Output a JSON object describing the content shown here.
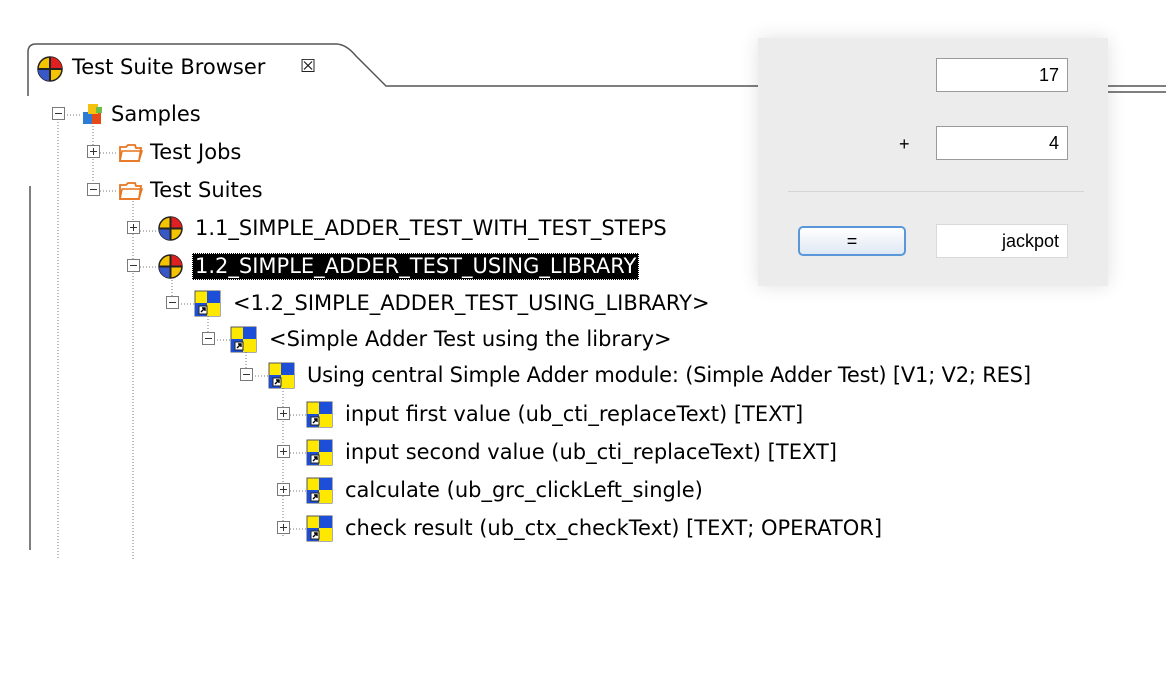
{
  "view": {
    "tab_title": "Test Suite Browser",
    "close_glyph": "☒",
    "tab_icon": "test-suite-icon"
  },
  "tree": {
    "rows": [
      {
        "label": "Samples",
        "icon": "category-icon"
      },
      {
        "label": "Test Jobs",
        "icon": "folder-icon"
      },
      {
        "label": "Test Suites",
        "icon": "folder-icon"
      },
      {
        "label": "1.1_SIMPLE_ADDER_TEST_WITH_TEST_STEPS",
        "icon": "test-suite-icon"
      },
      {
        "label": "1.2_SIMPLE_ADDER_TEST_USING_LIBRARY",
        "icon": "test-suite-icon",
        "selected": true
      },
      {
        "label": "<1.2_SIMPLE_ADDER_TEST_USING_LIBRARY>",
        "icon": "test-case-reference-icon"
      },
      {
        "label": "<Simple Adder Test using the library>",
        "icon": "test-case-reference-icon"
      },
      {
        "label": "Using central Simple Adder module: (Simple Adder Test) [V1; V2; RES]",
        "icon": "test-case-reference-icon"
      },
      {
        "label": "input first value (ub_cti_replaceText) [TEXT]",
        "icon": "test-case-reference-icon"
      },
      {
        "label": "input second value (ub_cti_replaceText) [TEXT]",
        "icon": "test-case-reference-icon"
      },
      {
        "label": "calculate (ub_grc_clickLeft_single)",
        "icon": "test-case-reference-icon"
      },
      {
        "label": "check result (ub_ctx_checkText) [TEXT; OPERATOR]",
        "icon": "test-case-reference-icon"
      }
    ]
  },
  "calculator": {
    "value1": "17",
    "operator": "+",
    "value2": "4",
    "button_label": "=",
    "result": "jackpot",
    "accent_color": "#5a97d9"
  }
}
